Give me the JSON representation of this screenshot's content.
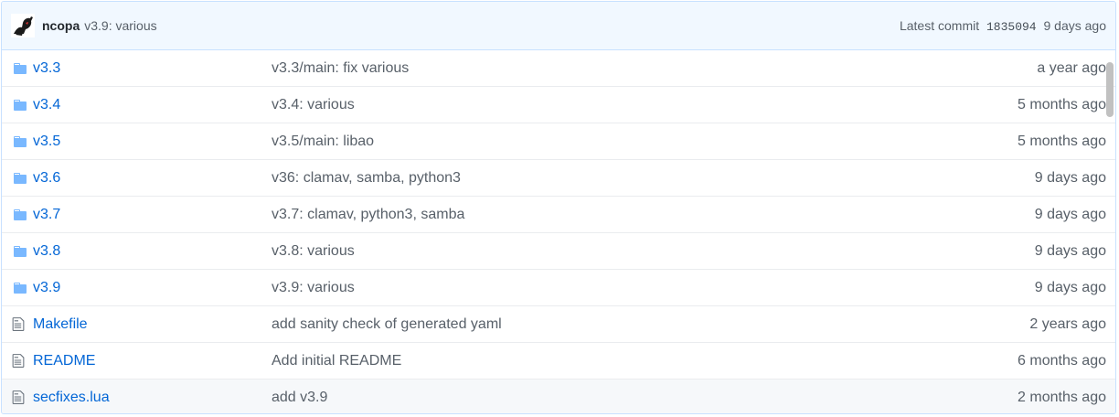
{
  "commit": {
    "author": "ncopa",
    "message": "v3.9: various",
    "latest_label": "Latest commit",
    "sha": "1835094",
    "age": "9 days ago"
  },
  "rows": [
    {
      "type": "folder",
      "name": "v3.3",
      "message": "v3.3/main: fix various",
      "age": "a year ago"
    },
    {
      "type": "folder",
      "name": "v3.4",
      "message": "v3.4: various",
      "age": "5 months ago"
    },
    {
      "type": "folder",
      "name": "v3.5",
      "message": "v3.5/main: libao",
      "age": "5 months ago"
    },
    {
      "type": "folder",
      "name": "v3.6",
      "message": "v36: clamav, samba, python3",
      "age": "9 days ago"
    },
    {
      "type": "folder",
      "name": "v3.7",
      "message": "v3.7: clamav, python3, samba",
      "age": "9 days ago"
    },
    {
      "type": "folder",
      "name": "v3.8",
      "message": "v3.8: various",
      "age": "9 days ago"
    },
    {
      "type": "folder",
      "name": "v3.9",
      "message": "v3.9: various",
      "age": "9 days ago"
    },
    {
      "type": "file",
      "name": "Makefile",
      "message": "add sanity check of generated yaml",
      "age": "2 years ago"
    },
    {
      "type": "file",
      "name": "README",
      "message": "Add initial README",
      "age": "6 months ago"
    },
    {
      "type": "file",
      "name": "secfixes.lua",
      "message": "add v3.9",
      "age": "2 months ago"
    }
  ],
  "colors": {
    "link": "#0366d6",
    "folder_icon": "#79b8ff",
    "muted": "#586069",
    "header_bg": "#f1f8ff"
  }
}
